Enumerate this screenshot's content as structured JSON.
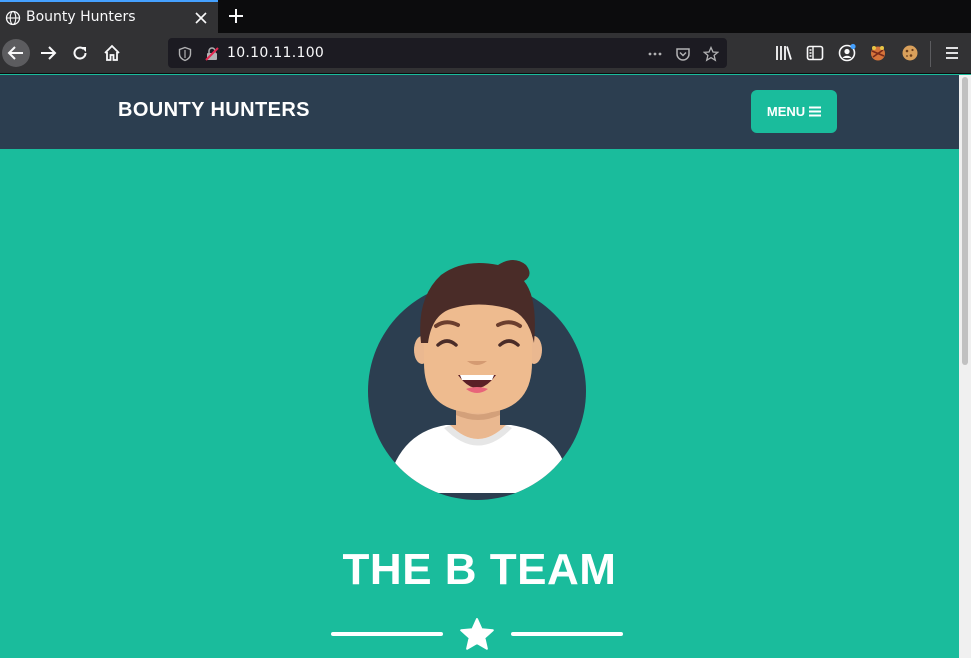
{
  "browser": {
    "tab_title": "Bounty Hunters",
    "url": "10.10.11.100"
  },
  "site": {
    "brand": "BOUNTY HUNTERS",
    "menu_label": "MENU",
    "hero_title": "THE B TEAM"
  },
  "icons": {
    "tab": [
      "globe-icon",
      "close-icon",
      "plus-icon"
    ],
    "nav": [
      "back-arrow-icon",
      "forward-arrow-icon",
      "reload-icon",
      "home-icon"
    ],
    "url": [
      "shield-icon",
      "insecure-lock-icon",
      "more-dots-icon",
      "pocket-icon",
      "star-icon"
    ],
    "tools": [
      "library-icon",
      "sidebar-icon",
      "account-icon",
      "extension-icon",
      "cookie-icon",
      "hamburger-icon"
    ]
  },
  "colors": {
    "accent": "#1abc9c",
    "header_bg": "#2c3e50",
    "browser_chrome": "#323234"
  }
}
